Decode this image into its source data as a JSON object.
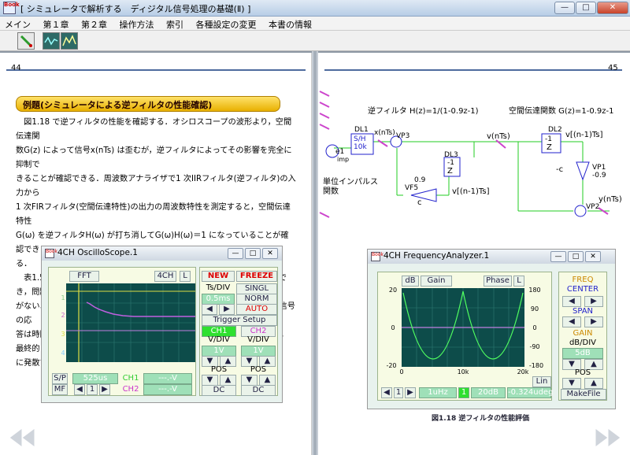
{
  "window": {
    "title": "[ シミュレータで解析する　ディジタル信号処理の基礎(Ⅱ) ]",
    "icon_text": "Book",
    "min": "—",
    "max": "□",
    "close": "✕"
  },
  "menu": [
    "メイン",
    "第１章",
    "第２章",
    "操作方法",
    "索引",
    "各種設定の変更",
    "本書の情報"
  ],
  "pages": {
    "left_number": "44",
    "right_number": "45"
  },
  "left": {
    "banner": "例題(シミュレータによる逆フィルタの性能確認)",
    "lines": [
      "　図1.18 で逆フィルタの性能を確認する．オシロスコープの波形より，空間伝達関",
      "数G(z) によって信号x(nTs) は歪むが，逆フィルタによってその影響を完全に抑制で",
      "きることが確認できる．周波数アナライザで1 次IIRフィルタ(逆フィルタ)の入力から",
      "1 次FIRフィルタ(空間伝達特性)の出力の周波数特性を測定すると，空間伝達特性",
      "G(ω) を逆フィルタH(ω) が打ち消してG(ω)H(ω)＝1 になっていることが確認でき",
      "る．",
      "　表1.5 よりc の値に無関係に空間伝達関数の影響を完全になくすことができ，問題",
      "がないように思われるが，|c|≧1 にすると，逆フィルタに一度入力された信号の応",
      "答は時間が経過しても減衰することなく，|c|＞1 であれば大きくなり続け，最終的",
      "に発散する．"
    ]
  },
  "oscilloscope": {
    "title": "4CH OscilloScope.1",
    "fft": "FFT",
    "ch4": "4CH",
    "l": "L",
    "new": "NEW",
    "freeze": "FREEZE",
    "ts_div": "Ts/DIV",
    "singl": "SINGL",
    "ts_value": "0.5ms",
    "norm": "NORM",
    "auto": "AUTO",
    "trigger": "Trigger Setup",
    "ch1": "CH1",
    "ch2": "CH2",
    "vdiv": "V/DIV",
    "v1": "1V",
    "v2": "1V",
    "pos": "POS",
    "dc1": "DC",
    "dc2": "DC",
    "sp": "S/P",
    "mf": "MF",
    "time": "525us",
    "ch1_label": "CH1",
    "ch2_label": "CH2",
    "ch1_value": "---.-V",
    "ch2_value": "---.-V",
    "page": "1",
    "markers": [
      "1",
      "2",
      "3",
      "4"
    ]
  },
  "diagram": {
    "inverse_title": "逆フィルタ H(z)=1/(1-0.9z-1)",
    "space_title": "空間伝達関数 G(z)=1-0.9z-1",
    "dl1": "DL1",
    "sh": "S/H",
    "sh_freq": "10k",
    "x_label": "x(nTs)",
    "vp3": "VP3",
    "e1": "e1",
    "e1_sub": "imp",
    "impulse_label": "単位インパルス",
    "impulse_label2": "関数",
    "dl3": "DL3",
    "z1": "-1",
    "z1_label": "Z",
    "vf5": "VF5",
    "vf5_gain": "0.9",
    "c": "c",
    "v_delay": "v[(n-1)Ts]",
    "v_label": "v(nTs)",
    "dl2": "DL2",
    "z2": "-1",
    "z2_label": "Z",
    "vdelay2": "v[(n-1)Ts]",
    "minus_c": "-c",
    "vp1": "VP1",
    "vp1_gain": "-0.9",
    "vp2": "VP2",
    "y_label": "y(nTs)"
  },
  "analyzer": {
    "title": "4CH FrequencyAnalyzer.1",
    "db": "dB",
    "gain": "Gain",
    "phase": "Phase",
    "l": "L",
    "y_left": [
      "20",
      "0",
      "-20"
    ],
    "y_right": [
      "180",
      "90",
      "0",
      "-90",
      "-180"
    ],
    "x_ticks": [
      "0",
      "10k",
      "20k"
    ],
    "lin": "Lin",
    "freq": "FREQ",
    "center": "CENTER",
    "span": "SPAN",
    "gain_lbl": "GAIN",
    "dbdiv": "dB/DIV",
    "gain_value": "5dB",
    "pos": "POS",
    "page": "1",
    "freq_value": "1uHz",
    "ch": "1",
    "db_value": "20dB",
    "deg_value": "-0.324udeg",
    "makefile": "MakeFile"
  },
  "caption": "図1.18 逆フィルタの性能評価",
  "colors": {
    "accent": "#4e6b9e",
    "scope_screen": "#0d4c4a",
    "trace": "#c060e0",
    "gain_trace": "#50ff60"
  }
}
